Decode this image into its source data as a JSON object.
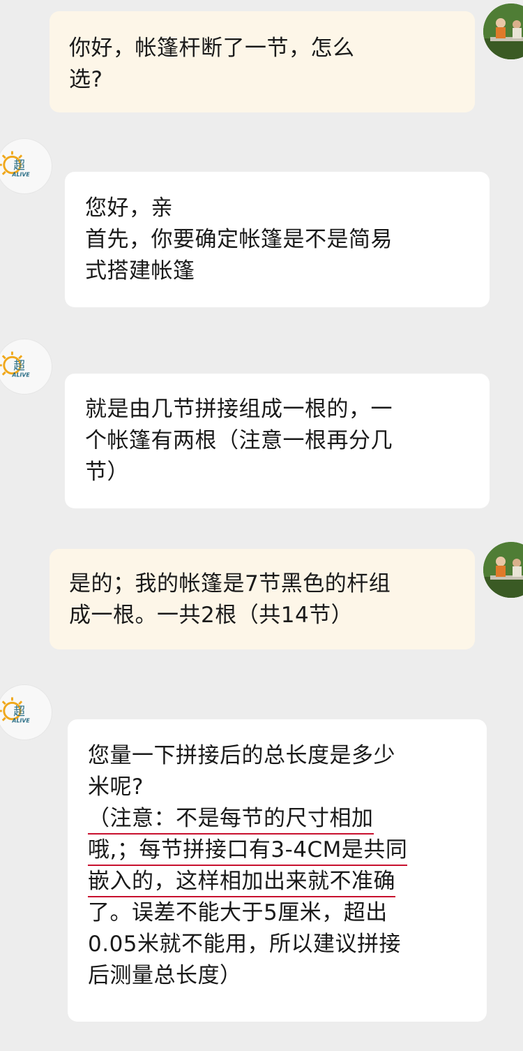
{
  "conversation": {
    "messages": [
      {
        "sender": "user",
        "lines": [
          "你好，帐篷杆断了一节，怎么",
          "选?"
        ]
      },
      {
        "sender": "agent",
        "lines": [
          "您好，亲",
          "首先，你要确定帐篷是不是简易",
          "式搭建帐篷"
        ]
      },
      {
        "sender": "agent",
        "lines": [
          "就是由几节拼接组成一根的，一",
          "个帐篷有两根（注意一根再分几",
          "节）"
        ]
      },
      {
        "sender": "user",
        "lines": [
          "是的；我的帐篷是7节黑色的杆组",
          "成一根。一共2根（共14节）"
        ]
      },
      {
        "sender": "agent",
        "lines": [
          "您量一下拼接后的总长度是多少",
          "米呢?",
          "（注意：不是每节的尺寸相加",
          "哦,；每节拼接口有3-4CM是共同",
          "嵌入的，这样相加出来就不准确",
          "了。误差不能大于5厘米，超出",
          "0.05米就不能用，所以建议拼接",
          "后测量总长度）"
        ]
      }
    ]
  },
  "avatars": {
    "agent_logo_text": "超越",
    "agent_logo_sub": "ALIVE"
  },
  "colors": {
    "background": "#ededed",
    "user_bubble": "#fdf6e8",
    "agent_bubble": "#ffffff",
    "underline": "#c8102e",
    "logo_sun": "#f0a81c"
  }
}
